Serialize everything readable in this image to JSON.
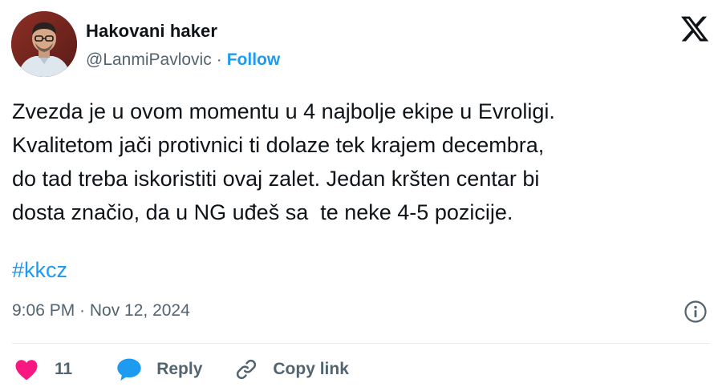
{
  "author": {
    "name": "Hakovani haker",
    "handle": "@LanmiPavlovic",
    "separator": "·",
    "follow_label": "Follow"
  },
  "brand_icon": "x-logo-icon",
  "tweet": {
    "lines": [
      "Zvezda je u ovom momentu u 4 najbolje ekipe u Evroligi.",
      "Kvalitetom jači protivnici ti dolaze tek krajem decembra,",
      "do tad treba iskoristiti ovaj zalet. Jedan kršten centar bi",
      "dosta značio, da u NG uđeš sa  te neke 4-5 pozicije."
    ],
    "hashtag": "#kkcz",
    "timestamp": "9:06 PM · Nov 12, 2024"
  },
  "actions": {
    "like_count": "11",
    "reply_label": "Reply",
    "copy_link_label": "Copy link"
  },
  "colors": {
    "accent": "#1d9bf0",
    "like": "#f91880",
    "text": "#0f1419",
    "secondary": "#536471"
  }
}
